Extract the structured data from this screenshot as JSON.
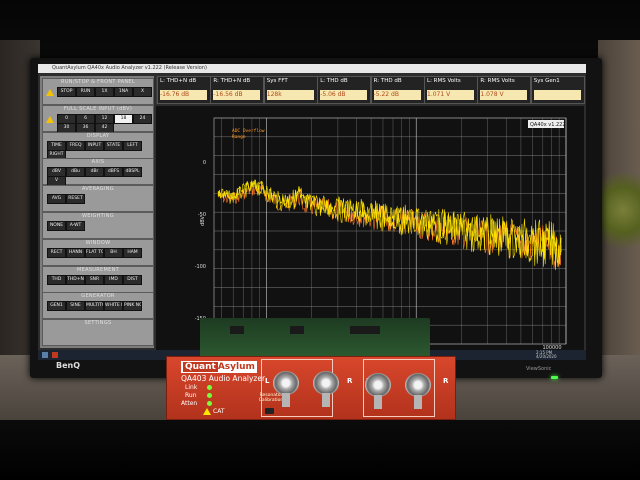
{
  "app": {
    "title_bar": "QuantAsylum QA40x Audio Analyzer v1.222 (Release Version)",
    "version_tag": "QA40x v1.222"
  },
  "left_panel": {
    "sections": [
      {
        "title": "RUN/STOP & FRONT PANEL",
        "buttons": [
          "STOP",
          "RUN",
          "1X",
          "1NA",
          "X"
        ]
      },
      {
        "title": "FULL SCALE INPUT (dBV)",
        "buttons": [
          "0",
          "6",
          "12",
          "18",
          "24",
          "30",
          "36",
          "42"
        ],
        "selected": "18",
        "note": "AC\nCOUPLED"
      },
      {
        "title": "DISPLAY",
        "buttons": [
          "TIME",
          "FREQ",
          "INPUT",
          "STATE",
          "LEFT",
          "RIGHT"
        ]
      },
      {
        "title": "AXIS",
        "buttons": [
          "dBV",
          "dBu",
          "dBr",
          "dBFS",
          "dBSPL",
          "V"
        ]
      },
      {
        "title": "AVERAGING",
        "buttons": [
          "AVG",
          "RESET"
        ]
      },
      {
        "title": "WEIGHTING",
        "buttons": [
          "NONE",
          "A-WT"
        ]
      },
      {
        "title": "WINDOW",
        "buttons": [
          "RECT",
          "HANN",
          "FLAT TOP",
          "BH",
          "HAM"
        ]
      },
      {
        "title": "MEASUREMENT",
        "buttons": [
          "THD",
          "THD+N",
          "SNR",
          "IMD",
          "DIST"
        ]
      },
      {
        "title": "GENERATOR",
        "buttons": [
          "GEN1",
          "SINE",
          "MULTITONE",
          "WHITE NOISE",
          "PINK NOISE"
        ]
      },
      {
        "title": "SETTINGS",
        "buttons": []
      }
    ]
  },
  "meters": [
    {
      "label": "L: THD+N dB",
      "value": "-16.76 dB"
    },
    {
      "label": "R: THD+N dB",
      "value": "-16.56 dB"
    },
    {
      "label": "Sys FFT",
      "value": "128k"
    },
    {
      "label": "L: THD dB",
      "value": "-5.06 dB"
    },
    {
      "label": "R: THD dB",
      "value": "-5.22 dB"
    },
    {
      "label": "L: RMS Volts",
      "value": "1.071 V"
    },
    {
      "label": "R: RMS Volts",
      "value": "1.078 V"
    },
    {
      "label": "Sys Gen1",
      "value": ""
    }
  ],
  "plot": {
    "warnings": [
      "ADC Overflow",
      "Range"
    ],
    "y_axis_label": "dBV",
    "x_ticks": [
      "10000",
      "100000"
    ],
    "y_ticks": [
      "0",
      "-50",
      "-100",
      "-150"
    ],
    "trace_colors": {
      "left": "#ffe600",
      "right": "#ff7a2a"
    }
  },
  "device": {
    "brand_a": "Quant",
    "brand_b": "Asylum",
    "model": "QA403 Audio Analyzer",
    "status_labels": [
      "Link",
      "Run",
      "Atten"
    ],
    "led_colors": {
      "link": "#79ff3a",
      "run": "#79ff3a",
      "atten": "#79ff3a"
    },
    "small_text": "Resonator\nCalibration",
    "cat": "CAT",
    "input_label": "IN",
    "output_label": "OUT",
    "channel_l": "L",
    "channel_r": "R"
  },
  "monitor": {
    "brand": "BenQ",
    "corner_brand": "ViewSonic"
  },
  "taskbar": {
    "clock": "2:15 PM\n4/20/2020"
  },
  "colors": {
    "device_red": "#c0391f",
    "plot_bg": "#111111",
    "meter_value_bg": "#f7e7b0"
  }
}
